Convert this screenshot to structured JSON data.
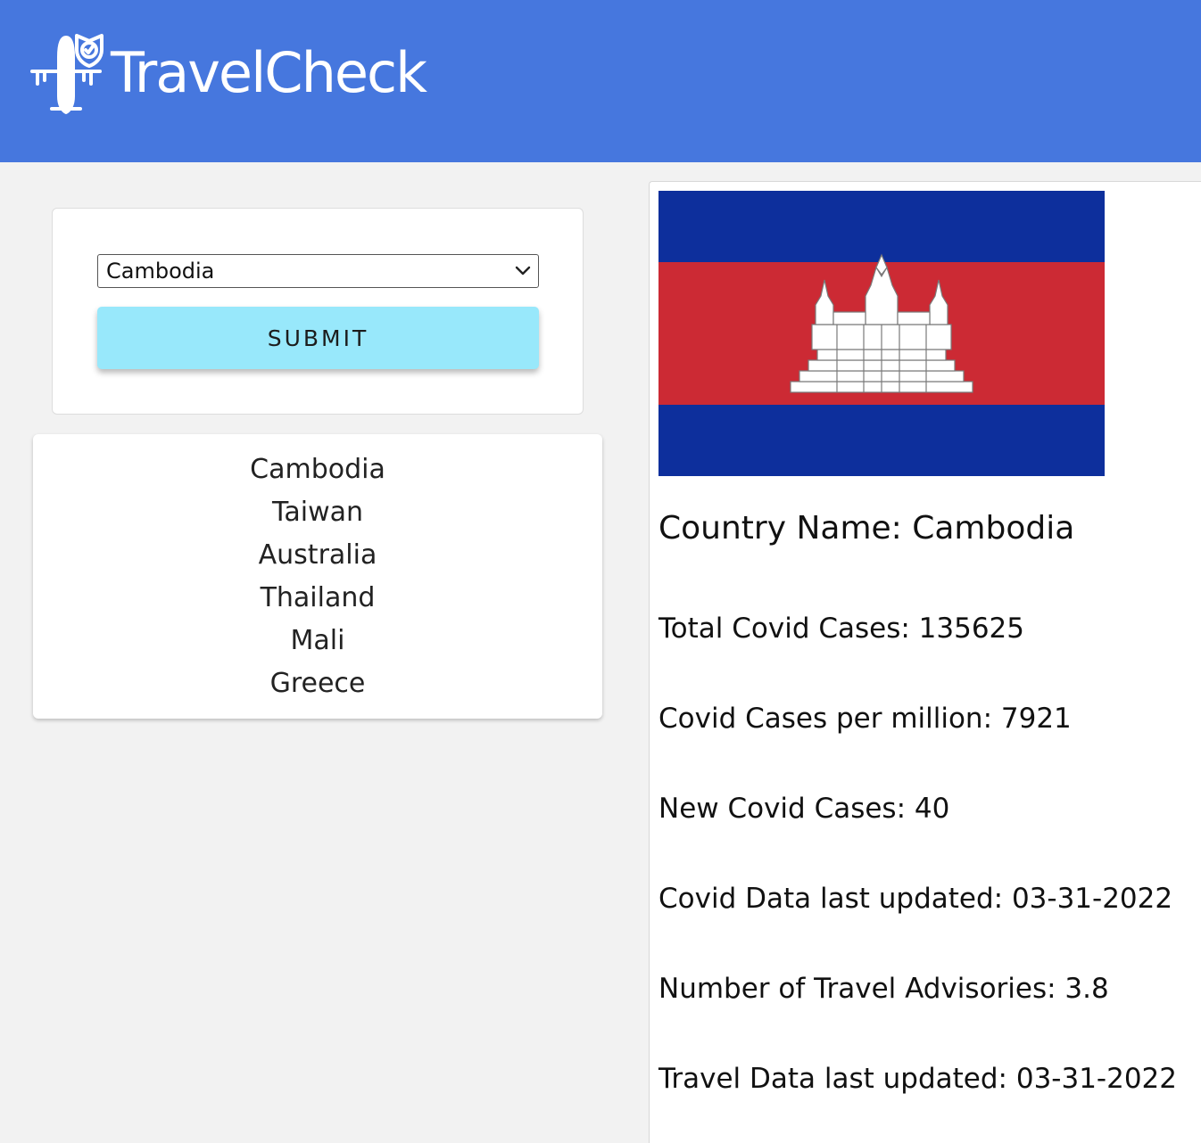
{
  "header": {
    "brand": "TravelCheck",
    "brand_color": "#4677de"
  },
  "search": {
    "selected_country": "Cambodia",
    "submit_label": "SUBMIT",
    "button_color": "#98e8fb"
  },
  "history": {
    "items": [
      "Cambodia",
      "Taiwan",
      "Australia",
      "Thailand",
      "Mali",
      "Greece"
    ]
  },
  "details": {
    "flag_icon": "cambodia-flag",
    "country_label": "Country Name: Cambodia",
    "stats": [
      "Total Covid Cases: 135625",
      "Covid Cases per million: 7921",
      "New Covid Cases: 40",
      "Covid Data last updated: 03-31-2022",
      "Number of Travel Advisories: 3.8",
      "Travel Data last updated: 03-31-2022"
    ]
  }
}
